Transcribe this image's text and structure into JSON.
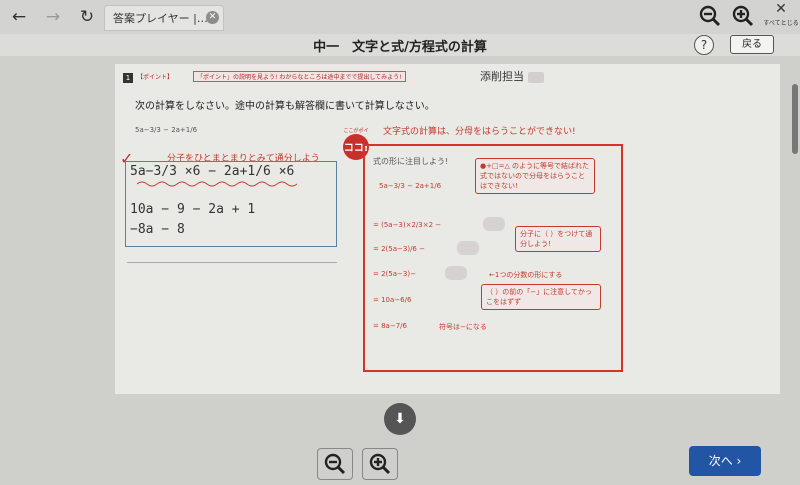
{
  "browser": {
    "tab_title": "答案プレイヤー |…",
    "close_all_label": "すべてとじる"
  },
  "header": {
    "title": "中一　文字と式/方程式の計算",
    "help_label": "?",
    "back_label": "戻る"
  },
  "worksheet": {
    "grader_label": "添削担当",
    "question_number": "1",
    "question_badge": "【ポイント】",
    "question_hint": "「ポイント」の説明を見よう! わからなところは途中までで提出してみよう!",
    "instruction": "次の計算をしなさい。途中の計算も解答欄に書いて計算しなさい。",
    "problem": "5a−3/3 − 2a+1/6",
    "tip": "分子をひとまとまりとみて通分しよう",
    "student_work": [
      "5a−3/3 ×6 − 2a+1/6 ×6",
      "10a − 9 − 2a + 1",
      "−8a − 8"
    ],
    "explanation_heading": "文字式の計算は、分母をはらうことができない!",
    "koko_top": "ここがポイント",
    "koko_label": "ココ!",
    "explanation": {
      "line0": "式の形に注目しよう!",
      "line1": "5a−3/3 − 2a+1/6",
      "line2": "= (5a−3)×2/3×2 −",
      "line3": "= 2(5a−3)/6 −",
      "line4": "= 2(5a−3)−",
      "line5": "= 10a−6/6",
      "line6": "= 8a−7/6",
      "callout1": "●+□=△ のように等号で結ばれた式ではないので分母をはらうことはできない!",
      "callout2": "分子に（ ）をつけて通分しよう!",
      "callout3": "（ ）の前の「−」に注意してかっこをはずず",
      "note1": "←1つの分数の形にする",
      "note2": "符号は−になる"
    }
  },
  "footer": {
    "next_label": "次へ ›"
  }
}
